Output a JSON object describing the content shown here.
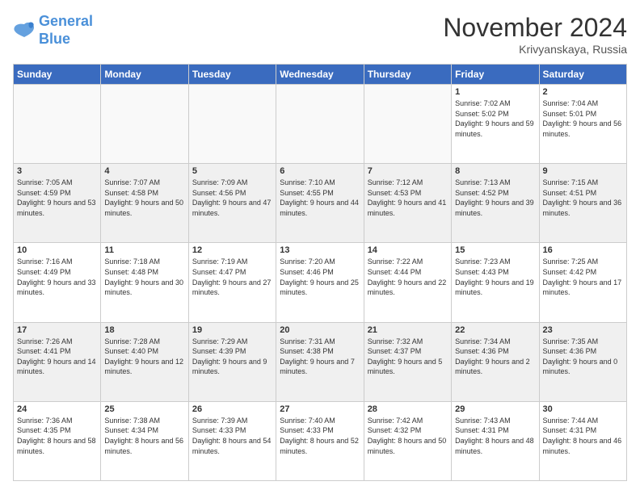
{
  "logo": {
    "line1": "General",
    "line2": "Blue"
  },
  "header": {
    "month": "November 2024",
    "location": "Krivyanskaya, Russia"
  },
  "weekdays": [
    "Sunday",
    "Monday",
    "Tuesday",
    "Wednesday",
    "Thursday",
    "Friday",
    "Saturday"
  ],
  "weeks": [
    [
      {
        "day": "",
        "info": ""
      },
      {
        "day": "",
        "info": ""
      },
      {
        "day": "",
        "info": ""
      },
      {
        "day": "",
        "info": ""
      },
      {
        "day": "",
        "info": ""
      },
      {
        "day": "1",
        "info": "Sunrise: 7:02 AM\nSunset: 5:02 PM\nDaylight: 9 hours and 59 minutes."
      },
      {
        "day": "2",
        "info": "Sunrise: 7:04 AM\nSunset: 5:01 PM\nDaylight: 9 hours and 56 minutes."
      }
    ],
    [
      {
        "day": "3",
        "info": "Sunrise: 7:05 AM\nSunset: 4:59 PM\nDaylight: 9 hours and 53 minutes."
      },
      {
        "day": "4",
        "info": "Sunrise: 7:07 AM\nSunset: 4:58 PM\nDaylight: 9 hours and 50 minutes."
      },
      {
        "day": "5",
        "info": "Sunrise: 7:09 AM\nSunset: 4:56 PM\nDaylight: 9 hours and 47 minutes."
      },
      {
        "day": "6",
        "info": "Sunrise: 7:10 AM\nSunset: 4:55 PM\nDaylight: 9 hours and 44 minutes."
      },
      {
        "day": "7",
        "info": "Sunrise: 7:12 AM\nSunset: 4:53 PM\nDaylight: 9 hours and 41 minutes."
      },
      {
        "day": "8",
        "info": "Sunrise: 7:13 AM\nSunset: 4:52 PM\nDaylight: 9 hours and 39 minutes."
      },
      {
        "day": "9",
        "info": "Sunrise: 7:15 AM\nSunset: 4:51 PM\nDaylight: 9 hours and 36 minutes."
      }
    ],
    [
      {
        "day": "10",
        "info": "Sunrise: 7:16 AM\nSunset: 4:49 PM\nDaylight: 9 hours and 33 minutes."
      },
      {
        "day": "11",
        "info": "Sunrise: 7:18 AM\nSunset: 4:48 PM\nDaylight: 9 hours and 30 minutes."
      },
      {
        "day": "12",
        "info": "Sunrise: 7:19 AM\nSunset: 4:47 PM\nDaylight: 9 hours and 27 minutes."
      },
      {
        "day": "13",
        "info": "Sunrise: 7:20 AM\nSunset: 4:46 PM\nDaylight: 9 hours and 25 minutes."
      },
      {
        "day": "14",
        "info": "Sunrise: 7:22 AM\nSunset: 4:44 PM\nDaylight: 9 hours and 22 minutes."
      },
      {
        "day": "15",
        "info": "Sunrise: 7:23 AM\nSunset: 4:43 PM\nDaylight: 9 hours and 19 minutes."
      },
      {
        "day": "16",
        "info": "Sunrise: 7:25 AM\nSunset: 4:42 PM\nDaylight: 9 hours and 17 minutes."
      }
    ],
    [
      {
        "day": "17",
        "info": "Sunrise: 7:26 AM\nSunset: 4:41 PM\nDaylight: 9 hours and 14 minutes."
      },
      {
        "day": "18",
        "info": "Sunrise: 7:28 AM\nSunset: 4:40 PM\nDaylight: 9 hours and 12 minutes."
      },
      {
        "day": "19",
        "info": "Sunrise: 7:29 AM\nSunset: 4:39 PM\nDaylight: 9 hours and 9 minutes."
      },
      {
        "day": "20",
        "info": "Sunrise: 7:31 AM\nSunset: 4:38 PM\nDaylight: 9 hours and 7 minutes."
      },
      {
        "day": "21",
        "info": "Sunrise: 7:32 AM\nSunset: 4:37 PM\nDaylight: 9 hours and 5 minutes."
      },
      {
        "day": "22",
        "info": "Sunrise: 7:34 AM\nSunset: 4:36 PM\nDaylight: 9 hours and 2 minutes."
      },
      {
        "day": "23",
        "info": "Sunrise: 7:35 AM\nSunset: 4:36 PM\nDaylight: 9 hours and 0 minutes."
      }
    ],
    [
      {
        "day": "24",
        "info": "Sunrise: 7:36 AM\nSunset: 4:35 PM\nDaylight: 8 hours and 58 minutes."
      },
      {
        "day": "25",
        "info": "Sunrise: 7:38 AM\nSunset: 4:34 PM\nDaylight: 8 hours and 56 minutes."
      },
      {
        "day": "26",
        "info": "Sunrise: 7:39 AM\nSunset: 4:33 PM\nDaylight: 8 hours and 54 minutes."
      },
      {
        "day": "27",
        "info": "Sunrise: 7:40 AM\nSunset: 4:33 PM\nDaylight: 8 hours and 52 minutes."
      },
      {
        "day": "28",
        "info": "Sunrise: 7:42 AM\nSunset: 4:32 PM\nDaylight: 8 hours and 50 minutes."
      },
      {
        "day": "29",
        "info": "Sunrise: 7:43 AM\nSunset: 4:31 PM\nDaylight: 8 hours and 48 minutes."
      },
      {
        "day": "30",
        "info": "Sunrise: 7:44 AM\nSunset: 4:31 PM\nDaylight: 8 hours and 46 minutes."
      }
    ]
  ]
}
